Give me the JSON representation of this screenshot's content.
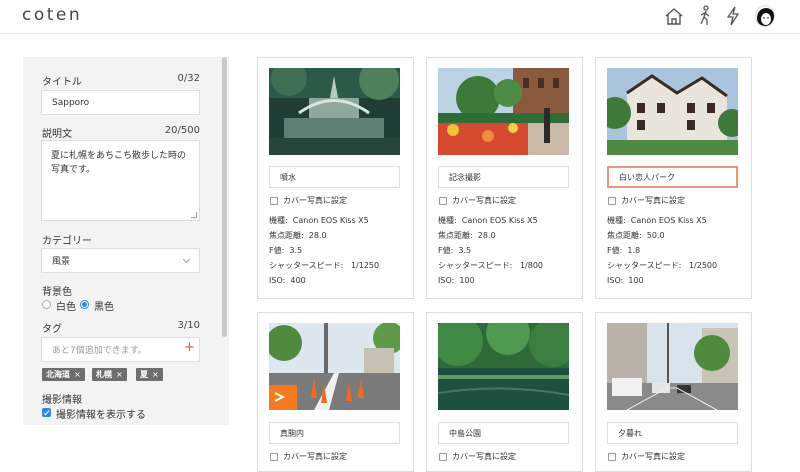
{
  "header": {
    "logo": "coten",
    "icons": [
      "home-icon",
      "walk-icon",
      "lightning-icon"
    ],
    "avatar": "avatar"
  },
  "sidebar": {
    "title_label": "タイトル",
    "title_count": "0/32",
    "title_value": "Sapporo",
    "desc_label": "説明文",
    "desc_count": "20/500",
    "desc_line1": "夏に札幌をあちこち散歩した時の",
    "desc_line2": "写真です。",
    "category_label": "カテゴリー",
    "category_value": "風景",
    "bg_label": "背景色",
    "bg_white": "白色",
    "bg_black": "黒色",
    "bg_selected": "黒色",
    "tag_label": "タグ",
    "tag_count": "3/10",
    "tag_placeholder": "あと7個追加できます。",
    "tags": [
      "北海道",
      "札幌",
      "夏"
    ],
    "shoot_label": "撮影情報",
    "shoot_check_label": "撮影情報を表示する"
  },
  "cover_label": "カバー写真に設定",
  "meta_labels": {
    "model": "機種:",
    "focal": "焦点距離:",
    "fnum": "F値:",
    "shutter": "シャッタースピード:",
    "iso": "ISO:"
  },
  "photos": [
    {
      "name": "噴水",
      "model": "Canon EOS Kiss X5",
      "focal": "28.0",
      "fnum": "3.5",
      "shutter": "1/1250",
      "iso": "400"
    },
    {
      "name": "記念撮影",
      "model": "Canon EOS Kiss X5",
      "focal": "28.0",
      "fnum": "3.5",
      "shutter": "1/800",
      "iso": "100"
    },
    {
      "name": "白い恋人パーク",
      "model": "Canon EOS Kiss X5",
      "focal": "50.0",
      "fnum": "1.8",
      "shutter": "1/2500",
      "iso": "100"
    },
    {
      "name": "真駒内"
    },
    {
      "name": "中島公園"
    },
    {
      "name": "夕暮れ"
    }
  ],
  "colors": {
    "accent": "#2f86ea",
    "plus": "#e8552d",
    "active_border": "#e9957a",
    "tag_bg": "#6e6e6e"
  }
}
